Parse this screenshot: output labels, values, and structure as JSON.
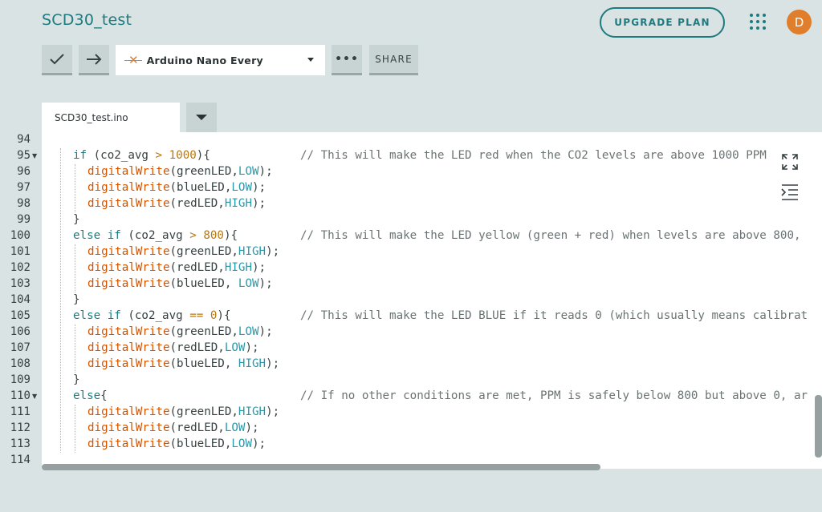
{
  "header": {
    "sketch_title": "SCD30_test",
    "upgrade_label": "UPGRADE PLAN",
    "avatar_initial": "D"
  },
  "toolbar": {
    "board_name": "Arduino Nano Every",
    "more_label": "•••",
    "share_label": "SHARE"
  },
  "tabs": {
    "file_name": "SCD30_test.ino"
  },
  "colors": {
    "accent": "#1d7a7f",
    "avatar": "#e07e2c"
  },
  "editor": {
    "line_numbers": [
      "94",
      "95",
      "96",
      "97",
      "98",
      "99",
      "100",
      "101",
      "102",
      "103",
      "104",
      "105",
      "106",
      "107",
      "108",
      "109",
      "110",
      "111",
      "112",
      "113",
      "114"
    ],
    "comments": {
      "c95": "// This will make the LED red when the CO2 levels are above 1000 PPM",
      "c100": "// This will make the LED yellow (green + red) when levels are above 800,",
      "c105": "// This will make the LED BLUE if it reads 0 (which usually means calibrat",
      "c110": "// If no other conditions are met, PPM is safely below 800 but above 0, ar"
    }
  }
}
